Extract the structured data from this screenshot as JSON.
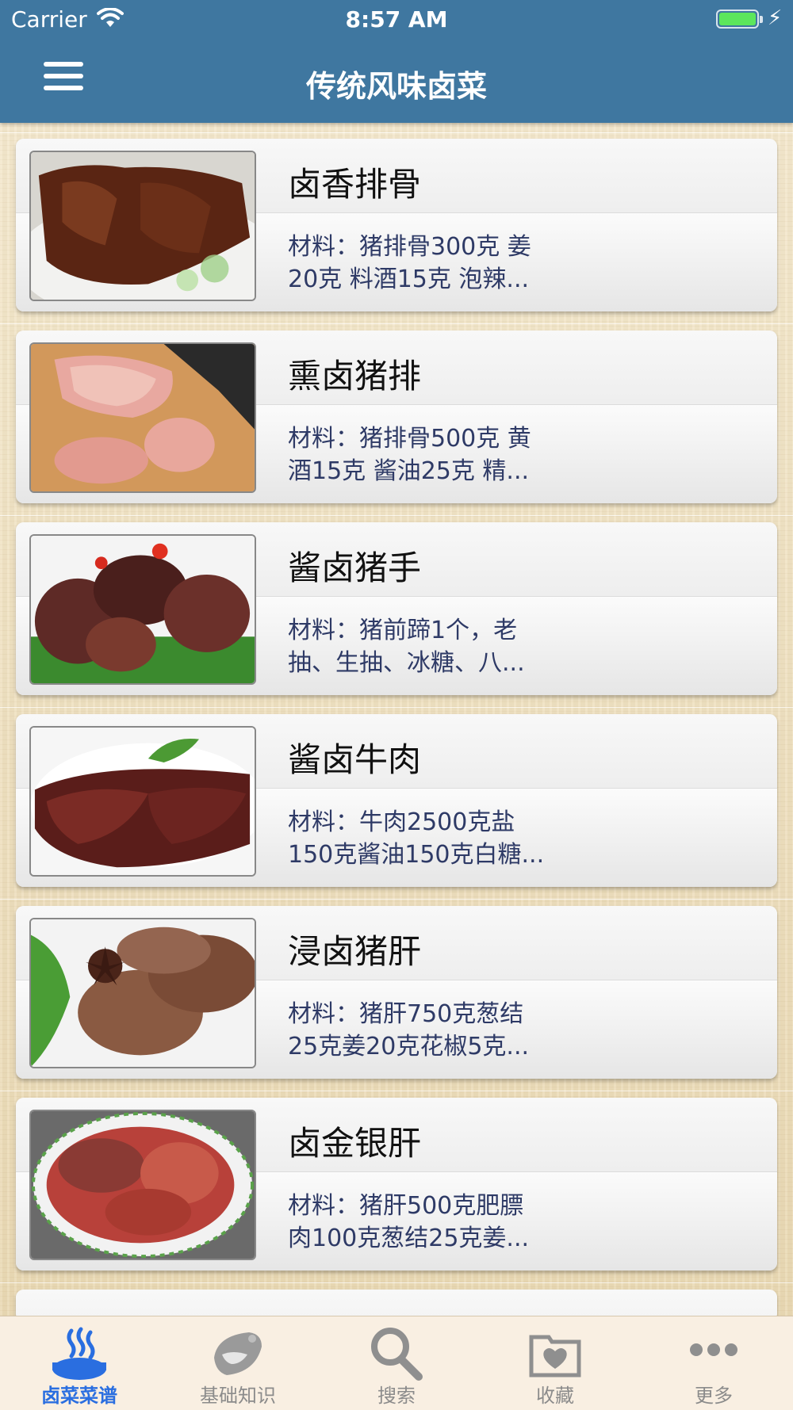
{
  "status_bar": {
    "carrier": "Carrier",
    "time": "8:57 AM"
  },
  "header": {
    "title": "传统风味卤菜"
  },
  "recipes": [
    {
      "title": "卤香排骨",
      "desc_line1": "材料：猪排骨300克 姜",
      "desc_line2": "20克 料酒15克 泡辣..."
    },
    {
      "title": "熏卤猪排",
      "desc_line1": "材料：猪排骨500克 黄",
      "desc_line2": "酒15克 酱油25克 精..."
    },
    {
      "title": "酱卤猪手",
      "desc_line1": "材料：猪前蹄1个，老",
      "desc_line2": "抽、生抽、冰糖、八..."
    },
    {
      "title": "酱卤牛肉",
      "desc_line1": "材料：牛肉2500克盐",
      "desc_line2": "150克酱油150克白糖..."
    },
    {
      "title": "浸卤猪肝",
      "desc_line1": "材料：猪肝750克葱结",
      "desc_line2": "25克姜20克花椒5克..."
    },
    {
      "title": "卤金银肝",
      "desc_line1": "材料：猪肝500克肥膘",
      "desc_line2": "肉100克葱结25克姜..."
    }
  ],
  "tabbar": {
    "tabs": [
      {
        "label": "卤菜菜谱",
        "icon": "grill-icon",
        "active": true
      },
      {
        "label": "基础知识",
        "icon": "dumpling-icon",
        "active": false
      },
      {
        "label": "搜索",
        "icon": "search-icon",
        "active": false
      },
      {
        "label": "收藏",
        "icon": "favorites-folder-icon",
        "active": false
      },
      {
        "label": "更多",
        "icon": "more-dots-icon",
        "active": false
      }
    ]
  },
  "colors": {
    "header": "#3f77a0",
    "active_tab": "#2a6ee0",
    "desc_text": "#2e3a66"
  }
}
